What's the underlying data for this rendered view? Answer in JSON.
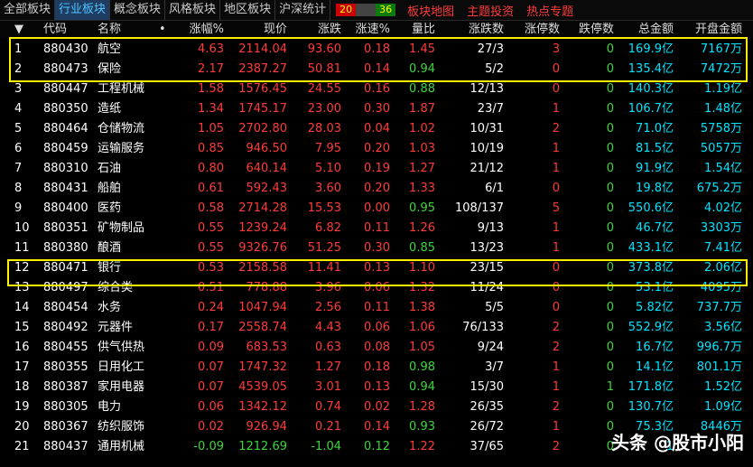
{
  "tabs": [
    {
      "label": "全部板块",
      "active": false
    },
    {
      "label": "行业板块",
      "active": true
    },
    {
      "label": "概念板块",
      "active": false
    },
    {
      "label": "风格板块",
      "active": false
    },
    {
      "label": "地区板块",
      "active": false
    },
    {
      "label": "沪深统计",
      "active": false
    }
  ],
  "counter": {
    "up": "20",
    "down": "36"
  },
  "links": [
    "板块地图",
    "主题投资",
    "热点专题"
  ],
  "columns": {
    "sort_icon": "sort-down-icon",
    "code": "代码",
    "name": "名称",
    "dot": "•",
    "pct": "涨幅%",
    "price": "现价",
    "change": "涨跌",
    "speed": "涨速%",
    "ratio": "量比",
    "updown": "涨跌数",
    "limit_up": "涨停数",
    "limit_down": "跌停数",
    "amount": "总金额",
    "open_amount": "开盘金额"
  },
  "rows": [
    {
      "idx": "1",
      "code": "880430",
      "name": "航空",
      "pct": "4.63",
      "price": "2114.04",
      "change": "93.60",
      "speed": "0.18",
      "ratio": "1.45",
      "ratio_color": "#ff3b3b",
      "updown": "27/3",
      "limit_up": "3",
      "limit_down": "0",
      "amount": "169.9亿",
      "open_amount": "7167万",
      "color": "#ff3b3b"
    },
    {
      "idx": "2",
      "code": "880473",
      "name": "保险",
      "pct": "2.17",
      "price": "2387.27",
      "change": "50.81",
      "speed": "0.14",
      "ratio": "0.94",
      "ratio_color": "#3cd63c",
      "updown": "5/2",
      "limit_up": "0",
      "limit_down": "0",
      "amount": "135.4亿",
      "open_amount": "7472万",
      "color": "#ff3b3b"
    },
    {
      "idx": "3",
      "code": "880447",
      "name": "工程机械",
      "pct": "1.58",
      "price": "1576.45",
      "change": "24.55",
      "speed": "0.16",
      "ratio": "0.88",
      "ratio_color": "#3cd63c",
      "updown": "12/13",
      "limit_up": "0",
      "limit_down": "0",
      "amount": "140.3亿",
      "open_amount": "1.19亿",
      "color": "#ff3b3b"
    },
    {
      "idx": "4",
      "code": "880350",
      "name": "造纸",
      "pct": "1.34",
      "price": "1745.17",
      "change": "23.00",
      "speed": "0.30",
      "ratio": "1.87",
      "ratio_color": "#ff3b3b",
      "updown": "23/7",
      "limit_up": "1",
      "limit_down": "0",
      "amount": "106.7亿",
      "open_amount": "1.48亿",
      "color": "#ff3b3b"
    },
    {
      "idx": "5",
      "code": "880464",
      "name": "仓储物流",
      "pct": "1.05",
      "price": "2702.80",
      "change": "28.03",
      "speed": "0.04",
      "ratio": "1.02",
      "ratio_color": "#ff3b3b",
      "updown": "10/31",
      "limit_up": "2",
      "limit_down": "0",
      "amount": "71.0亿",
      "open_amount": "5758万",
      "color": "#ff3b3b"
    },
    {
      "idx": "6",
      "code": "880459",
      "name": "运输服务",
      "pct": "0.85",
      "price": "946.50",
      "change": "7.95",
      "speed": "0.20",
      "ratio": "1.03",
      "ratio_color": "#ff3b3b",
      "updown": "10/19",
      "limit_up": "1",
      "limit_down": "0",
      "amount": "81.5亿",
      "open_amount": "5057万",
      "color": "#ff3b3b"
    },
    {
      "idx": "7",
      "code": "880310",
      "name": "石油",
      "pct": "0.80",
      "price": "640.14",
      "change": "5.10",
      "speed": "0.19",
      "ratio": "1.27",
      "ratio_color": "#ff3b3b",
      "updown": "21/12",
      "limit_up": "1",
      "limit_down": "0",
      "amount": "91.9亿",
      "open_amount": "1.54亿",
      "color": "#ff3b3b"
    },
    {
      "idx": "8",
      "code": "880431",
      "name": "船舶",
      "pct": "0.61",
      "price": "592.43",
      "change": "3.60",
      "speed": "0.20",
      "ratio": "1.33",
      "ratio_color": "#ff3b3b",
      "updown": "6/1",
      "limit_up": "0",
      "limit_down": "0",
      "amount": "19.8亿",
      "open_amount": "675.2万",
      "color": "#ff3b3b"
    },
    {
      "idx": "9",
      "code": "880400",
      "name": "医药",
      "pct": "0.58",
      "price": "2714.28",
      "change": "15.53",
      "speed": "0.00",
      "ratio": "0.95",
      "ratio_color": "#3cd63c",
      "updown": "108/137",
      "limit_up": "5",
      "limit_down": "0",
      "amount": "550.6亿",
      "open_amount": "4.02亿",
      "color": "#ff3b3b"
    },
    {
      "idx": "10",
      "code": "880351",
      "name": "矿物制品",
      "pct": "0.55",
      "price": "1239.24",
      "change": "6.82",
      "speed": "0.11",
      "ratio": "1.26",
      "ratio_color": "#ff3b3b",
      "updown": "9/13",
      "limit_up": "1",
      "limit_down": "0",
      "amount": "46.7亿",
      "open_amount": "3303万",
      "color": "#ff3b3b"
    },
    {
      "idx": "11",
      "code": "880380",
      "name": "酿酒",
      "pct": "0.55",
      "price": "9326.76",
      "change": "51.25",
      "speed": "0.30",
      "ratio": "0.85",
      "ratio_color": "#3cd63c",
      "updown": "13/23",
      "limit_up": "1",
      "limit_down": "0",
      "amount": "433.1亿",
      "open_amount": "7.41亿",
      "color": "#ff3b3b"
    },
    {
      "idx": "12",
      "code": "880471",
      "name": "银行",
      "pct": "0.53",
      "price": "2158.58",
      "change": "11.41",
      "speed": "0.13",
      "ratio": "1.10",
      "ratio_color": "#ff3b3b",
      "updown": "23/15",
      "limit_up": "0",
      "limit_down": "0",
      "amount": "373.8亿",
      "open_amount": "2.06亿",
      "color": "#ff3b3b"
    },
    {
      "idx": "13",
      "code": "880497",
      "name": "综合类",
      "pct": "0.51",
      "price": "778.88",
      "change": "3.96",
      "speed": "0.06",
      "ratio": "1.32",
      "ratio_color": "#ff3b3b",
      "updown": "11/24",
      "limit_up": "0",
      "limit_down": "0",
      "amount": "53.1亿",
      "open_amount": "4095万",
      "color": "#ff3b3b"
    },
    {
      "idx": "14",
      "code": "880454",
      "name": "水务",
      "pct": "0.24",
      "price": "1047.94",
      "change": "2.56",
      "speed": "0.11",
      "ratio": "1.38",
      "ratio_color": "#ff3b3b",
      "updown": "5/5",
      "limit_up": "0",
      "limit_down": "0",
      "amount": "5.82亿",
      "open_amount": "737.7万",
      "color": "#ff3b3b"
    },
    {
      "idx": "15",
      "code": "880492",
      "name": "元器件",
      "pct": "0.17",
      "price": "2558.74",
      "change": "4.43",
      "speed": "0.06",
      "ratio": "1.06",
      "ratio_color": "#ff3b3b",
      "updown": "76/133",
      "limit_up": "2",
      "limit_down": "0",
      "amount": "552.9亿",
      "open_amount": "3.56亿",
      "color": "#ff3b3b"
    },
    {
      "idx": "16",
      "code": "880455",
      "name": "供气供热",
      "pct": "0.09",
      "price": "683.53",
      "change": "0.63",
      "speed": "0.08",
      "ratio": "1.05",
      "ratio_color": "#ff3b3b",
      "updown": "9/24",
      "limit_up": "2",
      "limit_down": "0",
      "amount": "16.7亿",
      "open_amount": "996.7万",
      "color": "#ff3b3b"
    },
    {
      "idx": "17",
      "code": "880355",
      "name": "日用化工",
      "pct": "0.07",
      "price": "1747.32",
      "change": "1.27",
      "speed": "0.18",
      "ratio": "0.98",
      "ratio_color": "#3cd63c",
      "updown": "3/7",
      "limit_up": "1",
      "limit_down": "0",
      "amount": "14.1亿",
      "open_amount": "801.1万",
      "color": "#ff3b3b"
    },
    {
      "idx": "18",
      "code": "880387",
      "name": "家用电器",
      "pct": "0.07",
      "price": "4539.05",
      "change": "3.01",
      "speed": "0.13",
      "ratio": "0.94",
      "ratio_color": "#3cd63c",
      "updown": "15/30",
      "limit_up": "1",
      "limit_down": "1",
      "amount": "171.8亿",
      "open_amount": "1.52亿",
      "color": "#ff3b3b"
    },
    {
      "idx": "19",
      "code": "880305",
      "name": "电力",
      "pct": "0.06",
      "price": "1342.12",
      "change": "0.74",
      "speed": "0.02",
      "ratio": "1.28",
      "ratio_color": "#ff3b3b",
      "updown": "26/35",
      "limit_up": "2",
      "limit_down": "0",
      "amount": "130.7亿",
      "open_amount": "1.09亿",
      "color": "#ff3b3b"
    },
    {
      "idx": "20",
      "code": "880367",
      "name": "纺织服饰",
      "pct": "0.02",
      "price": "926.94",
      "change": "0.21",
      "speed": "0.14",
      "ratio": "0.93",
      "ratio_color": "#3cd63c",
      "updown": "26/72",
      "limit_up": "1",
      "limit_down": "0",
      "amount": "75.3亿",
      "open_amount": "8446万",
      "color": "#ff3b3b"
    },
    {
      "idx": "21",
      "code": "880437",
      "name": "通用机械",
      "pct": "-0.09",
      "price": "1212.69",
      "change": "-1.04",
      "speed": "0.12",
      "ratio": "1.22",
      "ratio_color": "#ff3b3b",
      "updown": "37/65",
      "limit_up": "2",
      "limit_down": "0",
      "amount": "1",
      "open_amount": "",
      "color": "#3cd63c"
    }
  ],
  "watermark": "头条 @股市小阳",
  "colors": {
    "up": "#ff3b3b",
    "down": "#3cd63c",
    "amount": "#00e5ff",
    "highlight": "#ffef00"
  }
}
